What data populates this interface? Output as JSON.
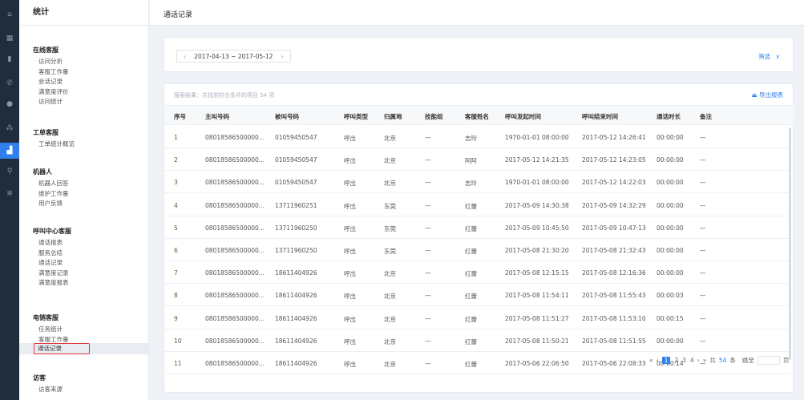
{
  "rail": {
    "icons": [
      {
        "name": "home-icon",
        "glyph": "⌂"
      },
      {
        "name": "grid-icon",
        "glyph": "▦"
      },
      {
        "name": "doc-icon",
        "glyph": "▮"
      },
      {
        "name": "phone-icon",
        "glyph": "✆"
      },
      {
        "name": "user-icon",
        "glyph": "●"
      },
      {
        "name": "team-icon",
        "glyph": "⁂"
      },
      {
        "name": "stats-icon",
        "glyph": "▟"
      },
      {
        "name": "search-icon",
        "glyph": "⚲"
      },
      {
        "name": "gear-icon",
        "glyph": "✲"
      }
    ]
  },
  "sidebar": {
    "title": "统计",
    "groups": [
      {
        "label": "在线客服",
        "items": [
          "访问分析",
          "客服工作量",
          "会话记录",
          "满意度评价",
          "访问统计"
        ]
      },
      {
        "label": "工单客服",
        "items": [
          "工单统计概览"
        ]
      },
      {
        "label": "机器人",
        "items": [
          "机器人回答",
          "维护工作量",
          "用户反馈"
        ]
      },
      {
        "label": "呼叫中心客服",
        "items": [
          "通话报表",
          "服务总结",
          "通话记录",
          "满意度记录",
          "满意度报表"
        ]
      },
      {
        "label": "电销客服",
        "items": [
          "任务统计",
          "客服工作量",
          "通话记录"
        ]
      },
      {
        "label": "访客",
        "items": [
          "访客来源"
        ]
      }
    ]
  },
  "header": {
    "title": "通话记录"
  },
  "filter": {
    "date_range": "2017-04-13 ~ 2017-05-12",
    "prev_glyph": "‹",
    "next_glyph": "›",
    "filter_label": "筛选",
    "filter_chevron": "∨"
  },
  "table": {
    "summary": "搜索结果：共找到符合条件的项目 54 项",
    "export_label": "导出报表",
    "columns": [
      "序号",
      "主叫号码",
      "被叫号码",
      "呼叫类型",
      "归属地",
      "技能组",
      "客服姓名",
      "呼叫发起时间",
      "呼叫结束时间",
      "通话时长",
      "备注"
    ],
    "rows": [
      [
        "1",
        "08018586500000...",
        "01059450547",
        "呼出",
        "北京",
        "—",
        "志玲",
        "1970-01-01 08:00:00",
        "2017-05-12 14:26:41",
        "00:00:00",
        "—"
      ],
      [
        "2",
        "08018586500000...",
        "01059450547",
        "呼出",
        "北京",
        "—",
        "阿阿",
        "2017-05-12 14:21:35",
        "2017-05-12 14:23:05",
        "00:00:00",
        "—"
      ],
      [
        "3",
        "08018586500000...",
        "01059450547",
        "呼出",
        "北京",
        "—",
        "志玲",
        "1970-01-01 08:00:00",
        "2017-05-12 14:22:03",
        "00:00:00",
        "—"
      ],
      [
        "4",
        "08018586500000...",
        "13711960251",
        "呼出",
        "东莞",
        "—",
        "红蕾",
        "2017-05-09 14:30:38",
        "2017-05-09 14:32:29",
        "00:00:00",
        "—"
      ],
      [
        "5",
        "08018586500000...",
        "13711960250",
        "呼出",
        "东莞",
        "—",
        "红蕾",
        "2017-05-09 10:45:50",
        "2017-05-09 10:47:13",
        "00:00:00",
        "—"
      ],
      [
        "6",
        "08018586500000...",
        "13711960250",
        "呼出",
        "东莞",
        "—",
        "红蕾",
        "2017-05-08 21:30:20",
        "2017-05-08 21:32:43",
        "00:00:00",
        "—"
      ],
      [
        "7",
        "08018586500000...",
        "18611404926",
        "呼出",
        "北京",
        "—",
        "红蕾",
        "2017-05-08 12:15:15",
        "2017-05-08 12:16:36",
        "00:00:00",
        "—"
      ],
      [
        "8",
        "08018586500000...",
        "18611404926",
        "呼出",
        "北京",
        "—",
        "红蕾",
        "2017-05-08 11:54:11",
        "2017-05-08 11:55:43",
        "00:00:03",
        "—"
      ],
      [
        "9",
        "08018586500000...",
        "18611404926",
        "呼出",
        "北京",
        "—",
        "红蕾",
        "2017-05-08 11:51:27",
        "2017-05-08 11:53:10",
        "00:00:15",
        "—"
      ],
      [
        "10",
        "08018586500000...",
        "18611404926",
        "呼出",
        "北京",
        "—",
        "红蕾",
        "2017-05-08 11:50:21",
        "2017-05-08 11:51:55",
        "00:00:00",
        "—"
      ],
      [
        "11",
        "08018586500000...",
        "18611404926",
        "呼出",
        "北京",
        "—",
        "红蕾",
        "2017-05-06 22:06:50",
        "2017-05-06 22:08:33",
        "00:00:14",
        "—"
      ]
    ]
  },
  "pagination": {
    "first": "«",
    "prev": "‹",
    "pages": [
      "1",
      "2",
      "3",
      "4"
    ],
    "next": "›",
    "last": "»",
    "total_prefix": "共",
    "total": "54",
    "total_suffix": "条",
    "jump_label": "跳至",
    "page_suffix": "页"
  },
  "colors": {
    "accent": "#2f80ed",
    "rail": "#1f2d3d",
    "highlight": "#e0383e"
  }
}
